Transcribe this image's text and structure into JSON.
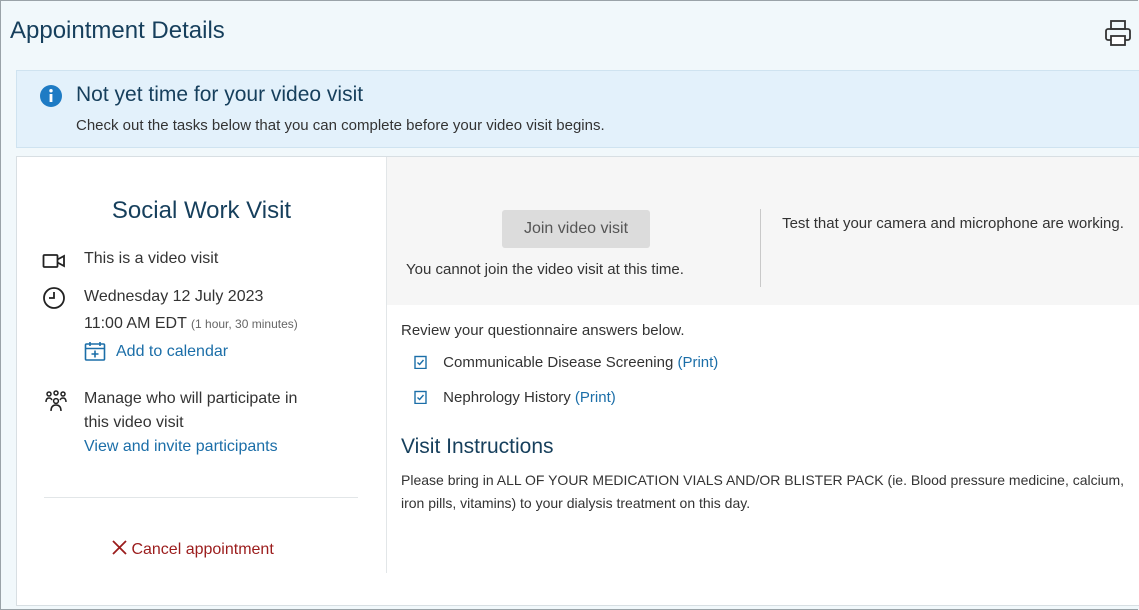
{
  "header": {
    "title": "Appointment Details",
    "print_icon": "printer-icon"
  },
  "banner": {
    "icon": "info-icon",
    "title": "Not yet time for your video visit",
    "message": "Check out the tasks below that you can complete before your video visit begins."
  },
  "visit": {
    "title": "Social Work Visit",
    "type_text": "This is a video visit",
    "date": "Wednesday 12 July 2023",
    "time": "11:00 AM EDT",
    "duration": "(1 hour, 30 minutes)",
    "add_to_calendar": "Add to calendar",
    "participants_line1": "Manage who will participate in",
    "participants_line2": "this video visit",
    "view_invite": "View and invite participants",
    "cancel": "Cancel appointment"
  },
  "video": {
    "join_label": "Join video visit",
    "cannot_join": "You cannot join the video visit at this time.",
    "test_message": "Test that your camera and microphone are working."
  },
  "questionnaires": {
    "intro": "Review your questionnaire answers below.",
    "items": [
      {
        "name": "Communicable Disease Screening",
        "print": "(Print)"
      },
      {
        "name": "Nephrology History",
        "print": "(Print)"
      }
    ]
  },
  "instructions": {
    "title": "Visit Instructions",
    "body": "Please bring in ALL OF YOUR MEDICATION VIALS AND/OR BLISTER PACK (ie. Blood pressure medicine, calcium, iron pills, vitamins) to your dialysis treatment on this day."
  },
  "colors": {
    "accent": "#1b6ea8",
    "heading": "#163f5c",
    "danger": "#9b1c1c",
    "banner_bg": "#e3f1fb"
  }
}
